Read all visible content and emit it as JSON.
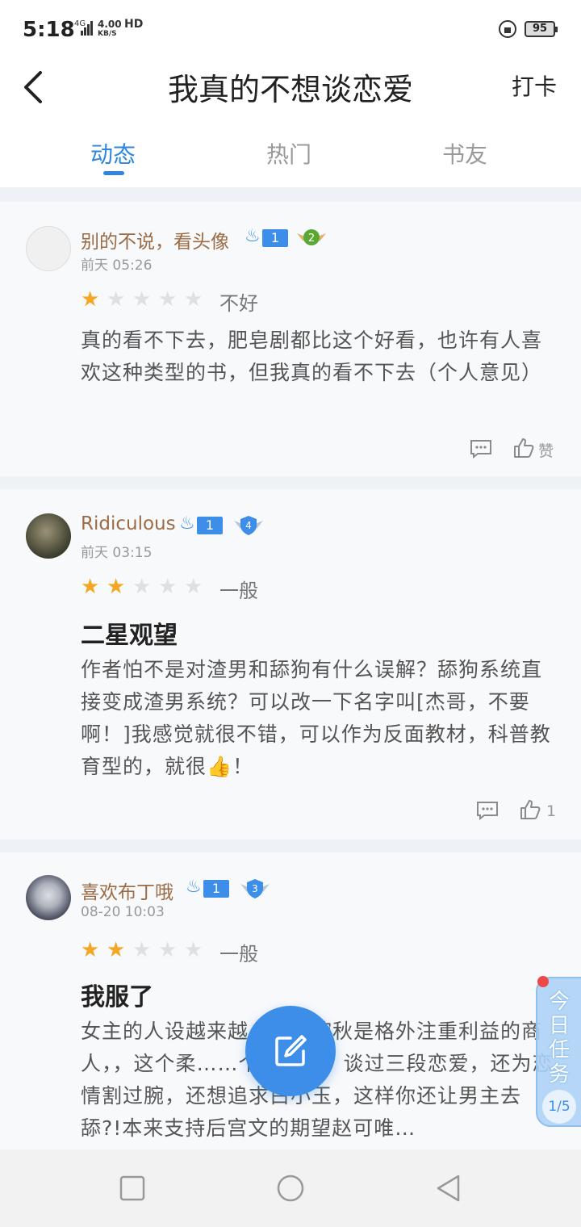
{
  "status_bar": {
    "time": "5:18",
    "network": "4G",
    "speed_value": "4.00",
    "speed_unit": "KB/S",
    "hd": "HD",
    "battery": "95"
  },
  "header": {
    "title": "我真的不想谈恋爱",
    "checkin_label": "打卡"
  },
  "tabs": [
    {
      "label": "动态"
    },
    {
      "label": "热门"
    },
    {
      "label": "书友"
    }
  ],
  "posts": [
    {
      "user": "别的不说，看头像",
      "level": "1",
      "badge_level": "2",
      "badge_color": "#5aa832",
      "time": "前天 05:26",
      "stars": 1,
      "rating_label": "不好",
      "title": "",
      "body": "真的看不下去，肥皂剧都比这个好看，也许有人喜欢这种类型的书，但我真的看不下去（个人意见）",
      "like_label": "赞"
    },
    {
      "user": "Ridiculous",
      "level": "1",
      "badge_level": "4",
      "badge_color": "#3d8ee8",
      "time": "前天 03:15",
      "stars": 2,
      "rating_label": "一般",
      "title": "二星观望",
      "body": "作者怕不是对渣男和舔狗有什么误解？舔狗系统直接变成渣男系统？可以改一下名字叫[杰哥，不要啊！]我感觉就很不错，可以作为反面教材，科普教育型的，就很👍！",
      "like_label": "1"
    },
    {
      "user": "喜欢布丁哦",
      "level": "1",
      "badge_level": "3",
      "badge_color": "#3d8ee8",
      "time": "08-20 10:03",
      "stars": 2,
      "rating_label": "一般",
      "title": "我服了",
      "body": "女主的人设越来越……林婉秋是格外注重利益的商人，，这个柔……个同性恋，谈过三段恋爱，还为恋情割过腕，还想追求白小玉，这样你还让男主去舔?!本来支持后宫文的期望赵可唯…"
    }
  ],
  "task_widget": {
    "label": "今日任务",
    "progress": "1/5"
  },
  "colors": {
    "accent": "#3d8ee8",
    "star_on": "#f5a623",
    "username": "#9b6b46"
  }
}
